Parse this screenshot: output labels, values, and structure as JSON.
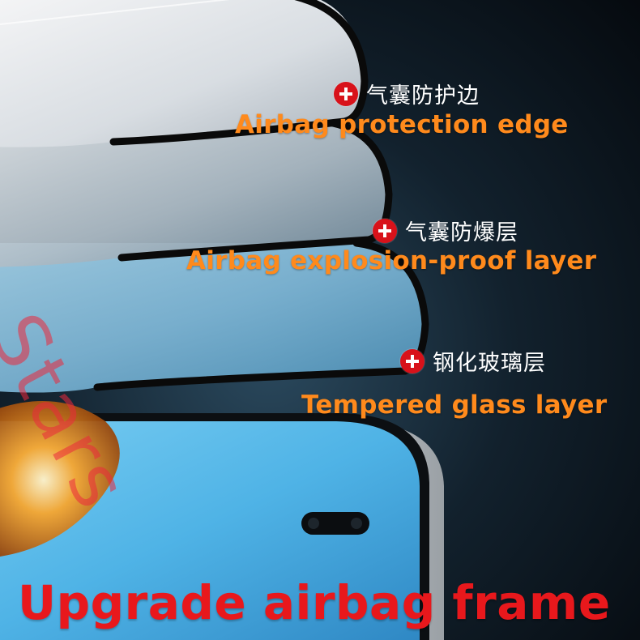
{
  "callouts": [
    {
      "icon": "plus-circle-icon",
      "cn": "气囊防护边",
      "en": "Airbag protection edge"
    },
    {
      "icon": "plus-circle-icon",
      "cn": "气囊防爆层",
      "en": "Airbag explosion-proof layer"
    },
    {
      "icon": "plus-circle-icon",
      "cn": "钢化玻璃层",
      "en": "Tempered glass layer"
    }
  ],
  "watermark": "Stars",
  "headline": "Upgrade airbag frame",
  "colors": {
    "headline": "#e8181c",
    "label_en": "#ff8a1c",
    "label_cn": "#ffffff",
    "badge": "#d8121a",
    "screen_blue": "#5ab7e6",
    "background": "#07121c"
  }
}
